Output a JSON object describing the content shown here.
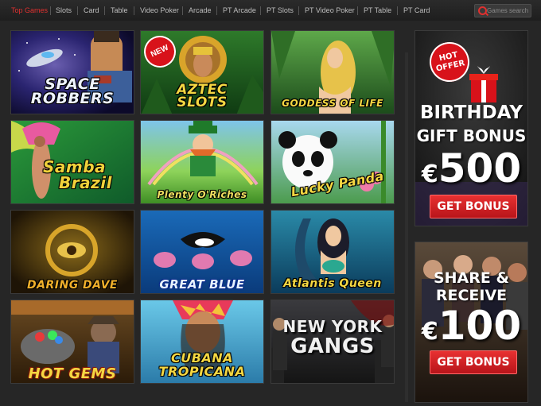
{
  "nav": {
    "items": [
      "Top Games",
      "Slots",
      "Card",
      "Table",
      "Video Poker",
      "Arcade",
      "PT Arcade",
      "PT Slots",
      "PT Video Poker",
      "PT Table",
      "PT Card"
    ],
    "active_index": 0,
    "search_placeholder": "Games search"
  },
  "games": [
    {
      "title": "SPACE ROBBERS",
      "line1": "SPACE",
      "line2": "ROBBERS",
      "badge": ""
    },
    {
      "title": "AZTEC SLOTS",
      "line1": "AZTEC",
      "line2": "SLOTS",
      "badge": "NEW"
    },
    {
      "title": "GODDESS OF LIFE",
      "line1": "GODDESS OF LIFE",
      "line2": "",
      "badge": ""
    },
    {
      "title": "Samba Brazil",
      "line1": "Samba",
      "line2": "Brazil",
      "badge": ""
    },
    {
      "title": "Plenty O'Riches",
      "line1": "Plenty O'Riches",
      "line2": "",
      "badge": ""
    },
    {
      "title": "Lucky Panda",
      "line1": "Lucky",
      "line2": "Panda",
      "badge": ""
    },
    {
      "title": "DARING DAVE",
      "line1": "DARING DAVE",
      "line2": "",
      "badge": ""
    },
    {
      "title": "GREAT BLUE",
      "line1": "GREAT BLUE",
      "line2": "",
      "badge": ""
    },
    {
      "title": "Atlantis Queen",
      "line1": "Atlantis Queen",
      "line2": "",
      "badge": ""
    },
    {
      "title": "HOT GEMS",
      "line1": "HOT GEMS",
      "line2": "",
      "badge": ""
    },
    {
      "title": "CUBANA TROPICANA",
      "line1": "CUBANA",
      "line2": "TROPICANA",
      "badge": ""
    },
    {
      "title": "NEW YORK GANGS",
      "line1": "NEW YORK",
      "line2": "GANGS",
      "badge": ""
    }
  ],
  "promos": [
    {
      "badge_line1": "HOT",
      "badge_line2": "OFFER",
      "line1": "BIRTHDAY",
      "line2": "GIFT BONUS",
      "currency": "€",
      "amount": "500",
      "button": "GET BONUS"
    },
    {
      "line1": "SHARE &",
      "line2": "RECEIVE",
      "currency": "€",
      "amount": "100",
      "button": "GET BONUS"
    }
  ],
  "colors": {
    "accent": "#e0302f",
    "nav_text": "#bdbdbd",
    "background": "#262626"
  }
}
